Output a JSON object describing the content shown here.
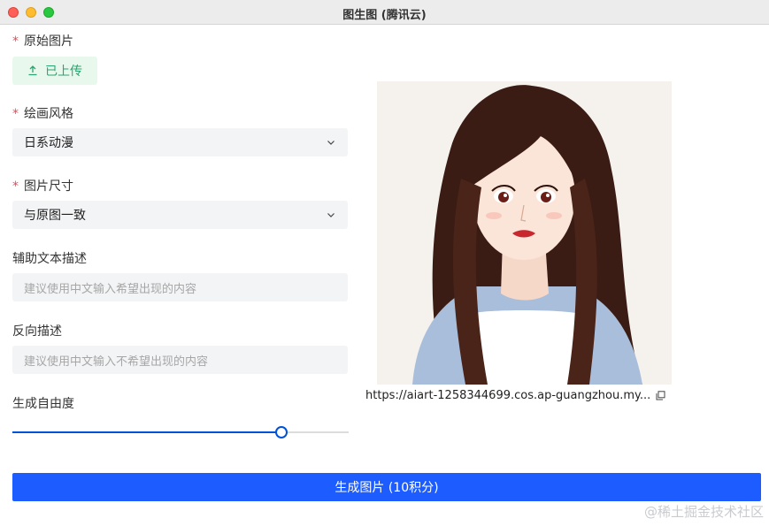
{
  "window": {
    "title": "图生图 (腾讯云)"
  },
  "form": {
    "required_mark": "*",
    "original_image": {
      "label": "原始图片",
      "button": "已上传"
    },
    "style": {
      "label": "绘画风格",
      "value": "日系动漫"
    },
    "size": {
      "label": "图片尺寸",
      "value": "与原图一致"
    },
    "prompt": {
      "label": "辅助文本描述",
      "placeholder": "建议使用中文输入希望出现的内容"
    },
    "negative": {
      "label": "反向描述",
      "placeholder": "建议使用中文输入不希望出现的内容"
    },
    "freedom": {
      "label": "生成自由度",
      "value": 0.8
    }
  },
  "generate_button": "生成图片 (10积分)",
  "result": {
    "url": "https://aiart-1258344699.cos.ap-guangzhou.my...",
    "image": "anime-style portrait of a woman with long brown hair"
  },
  "watermark": "@稀土掘金技术社区",
  "colors": {
    "primary": "#1d5cff",
    "slider": "#0052d9",
    "success": "#2ba471",
    "required": "#e34d59"
  }
}
